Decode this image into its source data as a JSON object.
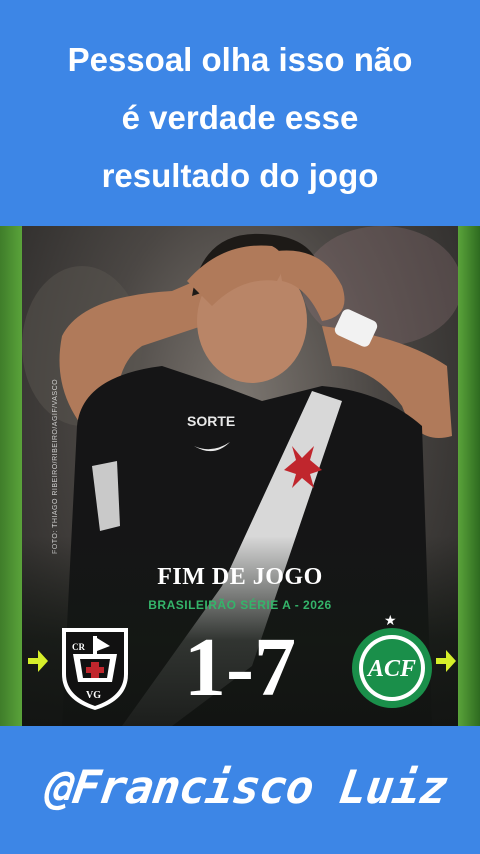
{
  "caption": {
    "line1": "Pessoal olha isso não",
    "line2": "é verdade esse",
    "line3": "resultado do jogo"
  },
  "post": {
    "photo_credit": "FOTO: THIAGO RIBEIRO/RIBEIRO/AGIF/VASCO",
    "title": "FIM DE JOGO",
    "competition": "BRASILEIRÃO SÉRIE A - 2026",
    "score": "1-7",
    "home_team": "Vasco",
    "away_team": "Chapecoense",
    "accent_green": "#34b56a",
    "arrow_color": "#d6ef2a"
  },
  "footer": {
    "handle": "@Francisco Luiz"
  }
}
